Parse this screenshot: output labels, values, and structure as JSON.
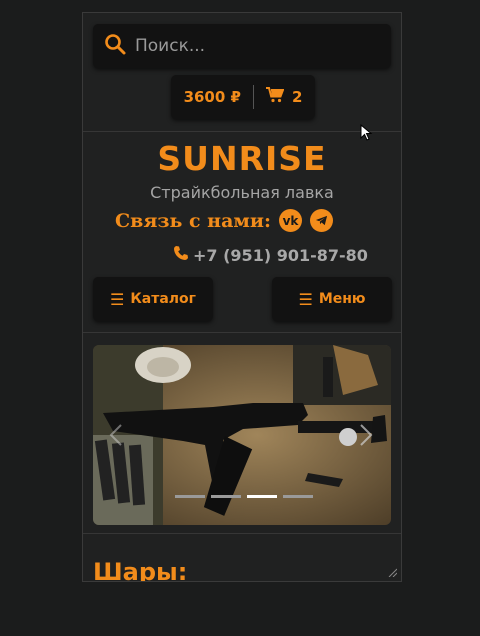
{
  "search": {
    "placeholder": "Поиск..."
  },
  "cart": {
    "total": "3600 ₽",
    "count": "2"
  },
  "brand": {
    "name": "SUNRISE",
    "tagline": "Страйкбольная лавка"
  },
  "contact": {
    "label": "Связь с нами:",
    "vk": "vk",
    "telegram": "telegram",
    "phone": "+7 (951) 901-87-80"
  },
  "nav": {
    "catalog_label": "Каталог",
    "menu_label": "Меню"
  },
  "slider": {
    "slide_count": 4,
    "active_index": 2
  },
  "section": {
    "heading": "Шары:"
  },
  "colors": {
    "accent": "#f28c1b",
    "panel": "#121212",
    "bg": "#202121"
  }
}
